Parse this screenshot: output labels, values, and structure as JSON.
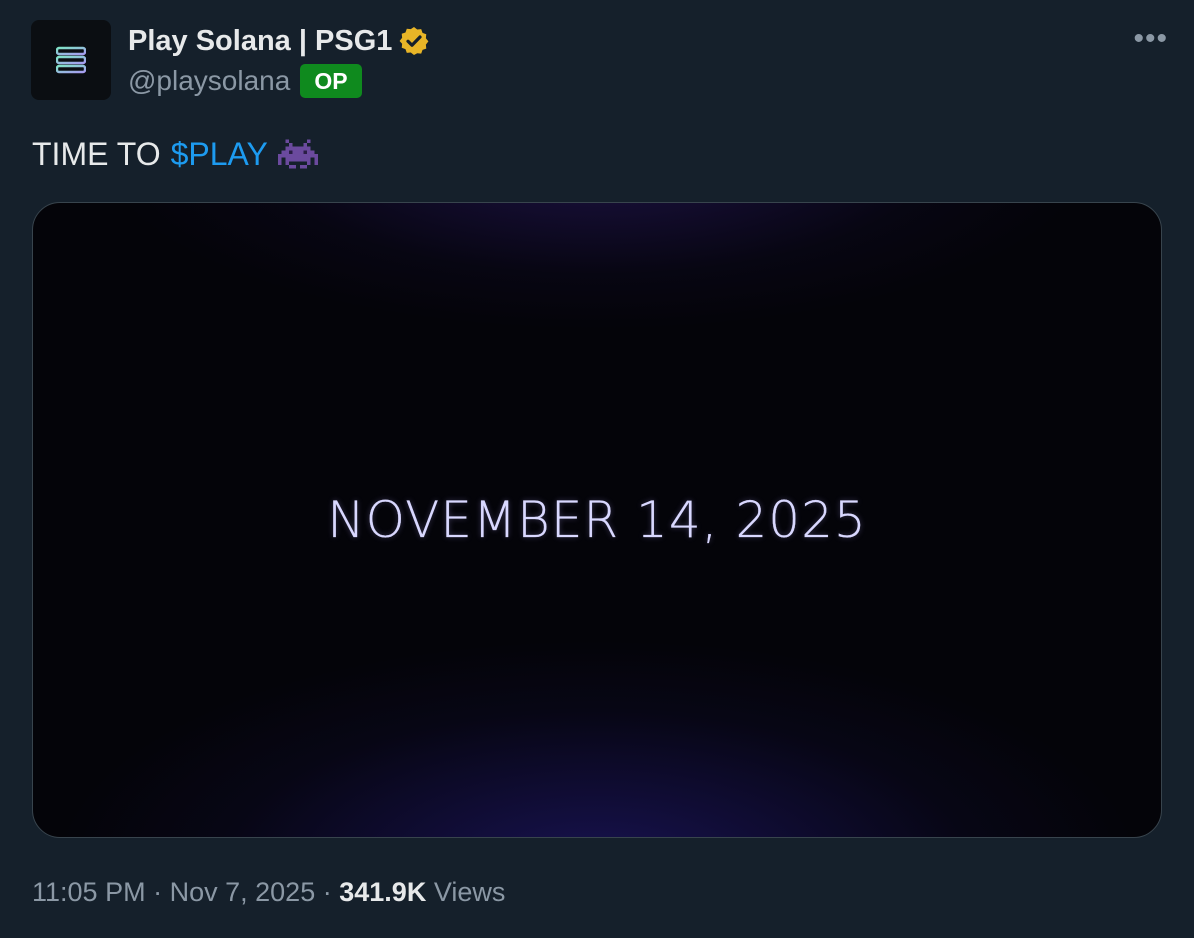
{
  "author": {
    "display_name": "Play Solana | PSG1",
    "handle": "@playsolana",
    "badge": "OP",
    "avatar_icon": "solana-logo-icon",
    "verified_icon": "gold-verified-badge-icon"
  },
  "more_icon": "more-options-icon",
  "tweet": {
    "text": "TIME TO",
    "cashtag": "$PLAY",
    "emoji": "alien-monster-emoji"
  },
  "media": {
    "date_text": "NOVEMBER 14, 2025"
  },
  "meta": {
    "time": "11:05 PM",
    "separator": "·",
    "date": "Nov 7, 2025",
    "views_count": "341.9K",
    "views_label": "Views"
  },
  "colors": {
    "background": "#15202b",
    "cashtag": "#1d9bf0",
    "op_badge": "#0f8a1e",
    "verified": "#e8b527"
  }
}
